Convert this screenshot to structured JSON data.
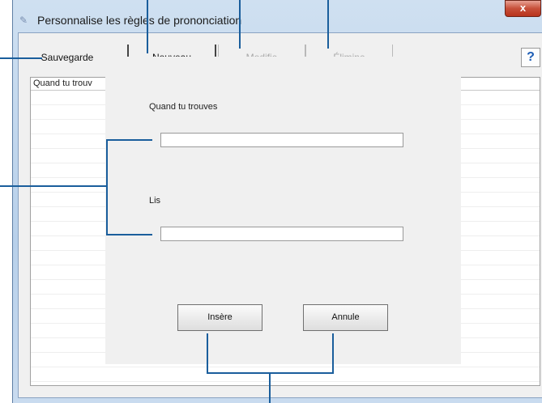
{
  "window": {
    "title": "Personnalise les règles de prononciation",
    "close_label": "x"
  },
  "tabs": [
    {
      "label": "Sauvegarde",
      "state": "enabled"
    },
    {
      "label": "Nouveau",
      "state": "active"
    },
    {
      "label": "Modifie",
      "state": "disabled"
    },
    {
      "label": "Élimine",
      "state": "disabled"
    }
  ],
  "help_label": "?",
  "list": {
    "header": "Quand tu trouv"
  },
  "dialog": {
    "find_label": "Quand tu trouves",
    "find_value": "",
    "read_label": "Lis",
    "read_value": "",
    "insert_label": "Insère",
    "cancel_label": "Annule"
  },
  "colors": {
    "callout": "#1a5e9c",
    "title_bar": "#c9dbef",
    "close_button": "#c7503a"
  },
  "icons": [
    "app-icon",
    "help-icon",
    "close-icon"
  ]
}
